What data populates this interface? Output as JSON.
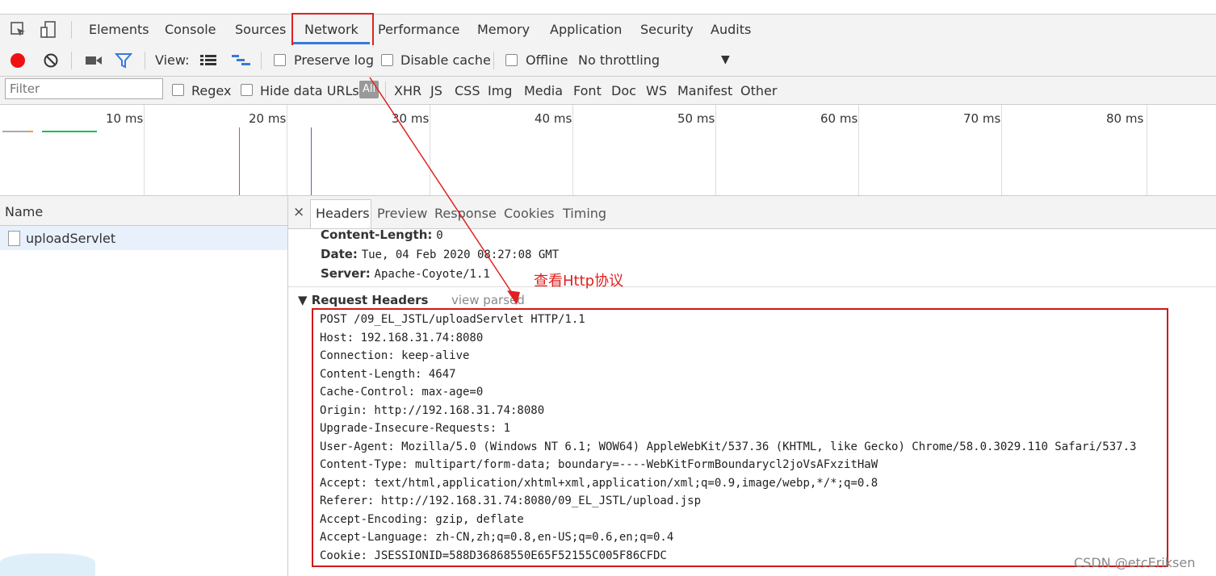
{
  "tabs": [
    "Elements",
    "Console",
    "Sources",
    "Network",
    "Performance",
    "Memory",
    "Application",
    "Security",
    "Audits"
  ],
  "active_tab": "Network",
  "toolbar": {
    "view_label": "View:",
    "preserve_log_label": "Preserve log",
    "disable_cache_label": "Disable cache",
    "offline_label": "Offline",
    "throttling_value": "No throttling"
  },
  "filterbar": {
    "filter_placeholder": "Filter",
    "regex_label": "Regex",
    "hide_data_urls_label": "Hide data URLs",
    "all_label": "All",
    "types": [
      "XHR",
      "JS",
      "CSS",
      "Img",
      "Media",
      "Font",
      "Doc",
      "WS",
      "Manifest",
      "Other"
    ]
  },
  "overview": {
    "ticks": [
      "10 ms",
      "20 ms",
      "30 ms",
      "40 ms",
      "50 ms",
      "60 ms",
      "70 ms",
      "80 ms"
    ]
  },
  "request_list": {
    "name_header": "Name",
    "requests": [
      "uploadServlet"
    ]
  },
  "details": {
    "close": "×",
    "tabs": [
      "Headers",
      "Preview",
      "Response",
      "Cookies",
      "Timing"
    ],
    "response_headers": [
      {
        "key": "Content-Length:",
        "value": "0"
      },
      {
        "key": "Date:",
        "value": "Tue, 04 Feb 2020 08:27:08 GMT"
      },
      {
        "key": "Server:",
        "value": "Apache-Coyote/1.1"
      }
    ],
    "request_headers_title": "▼ Request Headers",
    "view_parsed": "view parsed",
    "request_raw_lines": [
      "POST /09_EL_JSTL/uploadServlet HTTP/1.1",
      "Host: 192.168.31.74:8080",
      "Connection: keep-alive",
      "Content-Length: 4647",
      "Cache-Control: max-age=0",
      "Origin: http://192.168.31.74:8080",
      "Upgrade-Insecure-Requests: 1",
      "User-Agent: Mozilla/5.0 (Windows NT 6.1; WOW64) AppleWebKit/537.36 (KHTML, like Gecko) Chrome/58.0.3029.110 Safari/537.3",
      "Content-Type: multipart/form-data; boundary=----WebKitFormBoundarycl2joVsAFxzitHaW",
      "Accept: text/html,application/xhtml+xml,application/xml;q=0.9,image/webp,*/*;q=0.8",
      "Referer: http://192.168.31.74:8080/09_EL_JSTL/upload.jsp",
      "Accept-Encoding: gzip, deflate",
      "Accept-Language: zh-CN,zh;q=0.8,en-US;q=0.6,en;q=0.4",
      "Cookie: JSESSIONID=588D36868550E65F52155C005F86CFDC"
    ]
  },
  "annotation": "查看Http协议",
  "watermark": "CSDN @etcEriksen",
  "colors": {
    "annotation_red": "#e02020",
    "record_red": "#e11",
    "tab_blue": "#3879d9"
  }
}
